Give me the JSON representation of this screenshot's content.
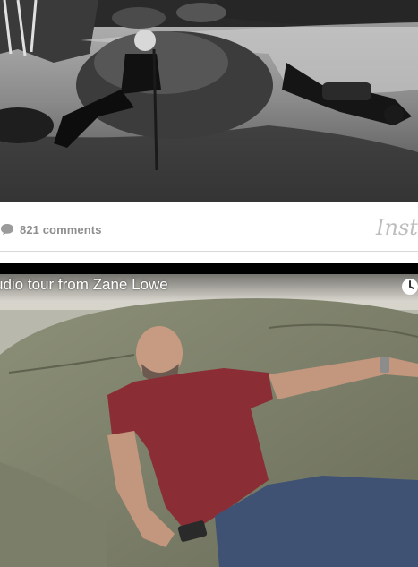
{
  "instagram_embed": {
    "comments_count": "821 comments",
    "logo_text": "Instag",
    "icons": {
      "comments": "comment-bubble-icon"
    },
    "colors": {
      "meta_text": "#8e8e8e",
      "logo": "#bdbdbd"
    }
  },
  "video_embed": {
    "title": "udio tour from Zane Lowe",
    "icons": {
      "watch_later": "clock-icon"
    }
  }
}
